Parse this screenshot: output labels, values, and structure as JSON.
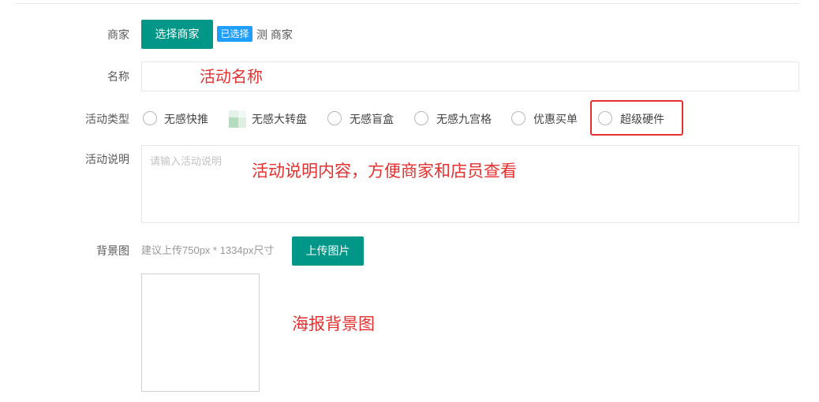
{
  "form": {
    "merchant": {
      "label": "商家",
      "button": "选择商家",
      "badge": "已选择",
      "value": "测 商家"
    },
    "name": {
      "label": "名称",
      "value": ""
    },
    "type": {
      "label": "活动类型",
      "options": [
        {
          "label": "无感快推",
          "icon": "radio-circle-icon"
        },
        {
          "label": "无感大转盘",
          "icon": "green-square-icon"
        },
        {
          "label": "无感盲盒",
          "icon": "radio-circle-icon"
        },
        {
          "label": "无感九宫格",
          "icon": "radio-circle-icon"
        },
        {
          "label": "优惠买单",
          "icon": "radio-circle-icon"
        },
        {
          "label": "超级硬件",
          "icon": "radio-circle-icon"
        }
      ]
    },
    "description": {
      "label": "活动说明",
      "placeholder": "请输入活动说明",
      "value": ""
    },
    "background": {
      "label": "背景图",
      "hint": "建议上传750px * 1334px尺寸",
      "button": "上传图片"
    }
  },
  "annotations": {
    "name": "活动名称",
    "description": "活动说明内容，方便商家和店员查看",
    "background": "海报背景图"
  },
  "colors": {
    "primary": "#009688",
    "badge": "#1E9FFF",
    "annotation": "#e53030"
  }
}
